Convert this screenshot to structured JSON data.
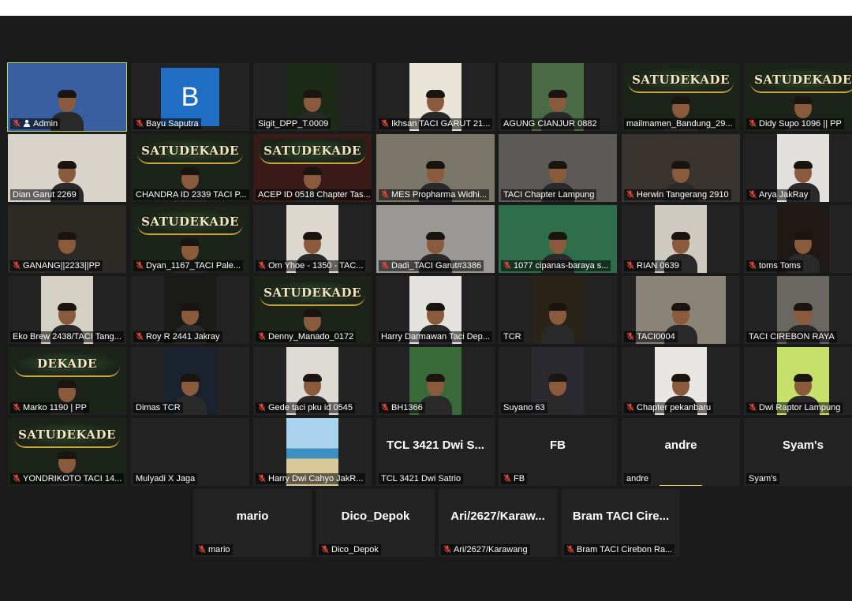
{
  "colors": {
    "background": "#1a1a1a",
    "tile": "#232323",
    "active_border": "#b6d84a",
    "muted_icon": "#e0463a",
    "avatar_blue": "#1f6ec4"
  },
  "participants": [
    {
      "name": "Admin",
      "muted": true,
      "host": true,
      "active": true,
      "video": "group-bright",
      "bg": "#3a5fa0"
    },
    {
      "name": "Bayu Saputra",
      "muted": true,
      "avatar_letter": "B"
    },
    {
      "name": "Sigit_DPP_T.0009",
      "muted": false,
      "video": "mid",
      "bg": "#1e2a18"
    },
    {
      "name": "Ikhsan TACI GARUT 21...",
      "muted": true,
      "video": "mid",
      "bg": "#e9e4d6"
    },
    {
      "name": "AGUNG CIANJUR 0882",
      "muted": false,
      "video": "mid",
      "bg": "#4a6b44"
    },
    {
      "name": "mailmamen_Bandung_29...",
      "muted": false,
      "logo": "SATUDEKADE",
      "bg": "#1c2419"
    },
    {
      "name": "Didy Supo 1096 || PP",
      "muted": true,
      "logo": "SATUDEKADE",
      "bg": "#1c2419"
    },
    {
      "name": "Dian Garut 2269",
      "muted": false,
      "video": "full",
      "bg": "#d8d4cc"
    },
    {
      "name": "CHANDRA ID 2339 TACI P...",
      "muted": false,
      "logo": "SATUDEKADE",
      "bg": "#1c2419"
    },
    {
      "name": "ACEP ID 0518 Chapter Tas...",
      "muted": false,
      "logo": "SATUDEKADE",
      "bg": "#3b1a1a"
    },
    {
      "name": "MES Propharma Widhi...",
      "muted": true,
      "video": "full",
      "bg": "#7a7668"
    },
    {
      "name": "TACI Chapter Lampung",
      "muted": false,
      "video": "full",
      "bg": "#5c5a56"
    },
    {
      "name": "Herwin Tangerang 2910",
      "muted": true,
      "video": "full",
      "bg": "#3a3430"
    },
    {
      "name": "Arya JakRay",
      "muted": true,
      "video": "mid",
      "bg": "#e2e0dc"
    },
    {
      "name": "GANANG||2233||PP",
      "muted": true,
      "video": "full",
      "bg": "#2e2a26"
    },
    {
      "name": "Dyan_1167_TACI Pale...",
      "muted": true,
      "logo": "SATUDEKADE",
      "bg": "#1c2419"
    },
    {
      "name": "Om Yhoe - 1350 - TAC...",
      "muted": true,
      "video": "mid",
      "bg": "#dcd8d0"
    },
    {
      "name": "Dadi_TACI Garut#3386",
      "muted": true,
      "video": "full",
      "bg": "#9a9894"
    },
    {
      "name": "1077 cipanas-baraya s...",
      "muted": true,
      "video": "full",
      "bg": "#2f6e4a"
    },
    {
      "name": "RIAN 0639",
      "muted": true,
      "video": "mid",
      "bg": "#cfcac0"
    },
    {
      "name": "toms Toms",
      "muted": true,
      "video": "mid",
      "bg": "#201814"
    },
    {
      "name": "Eko Brew 2438/TACI Tang...",
      "muted": false,
      "video": "mid",
      "bg": "#d6d0c4"
    },
    {
      "name": "Roy R 2441 Jakray",
      "muted": true,
      "video": "mid",
      "bg": "#1a1a18"
    },
    {
      "name": "Denny_Manado_0172",
      "muted": true,
      "logo": "SATUDEKADE",
      "bg": "#1c2419"
    },
    {
      "name": "Harry Darmawan Taci Dep...",
      "muted": false,
      "video": "mid",
      "bg": "#e4e2de"
    },
    {
      "name": "TCR",
      "muted": false,
      "video": "mid",
      "bg": "#2a2418"
    },
    {
      "name": "TACI0004",
      "muted": true,
      "video": "wide",
      "bg": "#8a8478"
    },
    {
      "name": "TACI CIREBON RAYA",
      "muted": false,
      "video": "mid",
      "bg": "#6a6660"
    },
    {
      "name": "Marko 1190 | PP",
      "muted": true,
      "logo": "DEKADE",
      "bg": "#1c2419"
    },
    {
      "name": "Dimas TCR",
      "muted": false,
      "video": "mid",
      "bg": "#1a2230"
    },
    {
      "name": "Gede taci pku id 0545",
      "muted": true,
      "video": "mid",
      "bg": "#dedad4"
    },
    {
      "name": "BH1366",
      "muted": true,
      "video": "mid",
      "bg": "#3a6a3a"
    },
    {
      "name": "Suyano 63",
      "muted": false,
      "video": "mid",
      "bg": "#2a2a30"
    },
    {
      "name": "Chapter pekanbaru",
      "muted": true,
      "video": "mid",
      "bg": "#e8e6e2"
    },
    {
      "name": "Dwi Raptor Lampung",
      "muted": true,
      "video": "mid",
      "bg": "#c6e06a"
    },
    {
      "name": "YONDRIKOTO TACI 14...",
      "muted": true,
      "logo": "SATUDEKADE",
      "bg": "#1c2419"
    },
    {
      "name": "Mulyadi X Jaga",
      "muted": false,
      "blank": true
    },
    {
      "name": "Harry Dwi Cahyo JakR...",
      "muted": true,
      "video": "beach",
      "bg": "#7fb8d8"
    },
    {
      "name": "TCL 3421 Dwi Satrio",
      "muted": false,
      "title": "TCL 3421 Dwi S..."
    },
    {
      "name": "FB",
      "muted": true,
      "title": "FB"
    },
    {
      "name": "andre",
      "muted": false,
      "title": "andre",
      "speaking": true
    },
    {
      "name": "Syam's",
      "muted": false,
      "title": "Syam's"
    }
  ],
  "last_row": [
    {
      "name": "mario",
      "muted": true,
      "title": "mario"
    },
    {
      "name": "Dico_Depok",
      "muted": true,
      "title": "Dico_Depok"
    },
    {
      "name": "Ari/2627/Karawang",
      "muted": true,
      "title": "Ari/2627/Karaw..."
    },
    {
      "name": "Bram TACI Cirebon Ra...",
      "muted": true,
      "title": "Bram TACI Cire..."
    }
  ]
}
